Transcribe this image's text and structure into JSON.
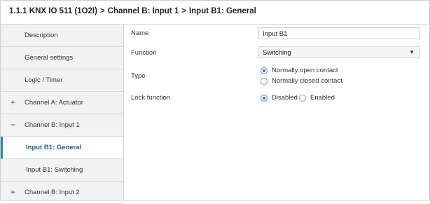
{
  "breadcrumb": {
    "device": "1.1.1 KNX IO 511 (1O2I)",
    "level1": "Channel B: Input 1",
    "level2": "Input B1: General",
    "separator": ">"
  },
  "sidebar": {
    "items": [
      {
        "label": "Description",
        "expander": ""
      },
      {
        "label": "General settings",
        "expander": ""
      },
      {
        "label": "Logic / Timer",
        "expander": ""
      },
      {
        "label": "Channel A: Actuator",
        "expander": "+"
      },
      {
        "label": "Channel B: Input 1",
        "expander": "−"
      },
      {
        "label": "Input B1: General",
        "expander": "",
        "active": true
      },
      {
        "label": "Input B1: Switching",
        "expander": ""
      },
      {
        "label": "Channel B: Input 2",
        "expander": "+"
      }
    ]
  },
  "params": {
    "name": {
      "label": "Name",
      "value": "Input B1"
    },
    "function": {
      "label": "Function",
      "value": "Switching",
      "icon": "chevron-down-icon"
    },
    "type": {
      "label": "Type",
      "options": [
        {
          "label": "Normally open contact",
          "selected": true
        },
        {
          "label": "Normally closed contact",
          "selected": false
        }
      ]
    },
    "lock": {
      "label": "Lock function",
      "options": [
        {
          "label": "Disabled",
          "selected": true
        },
        {
          "label": "Enabled",
          "selected": false
        }
      ]
    }
  },
  "colors": {
    "accent": "#2e8a9e",
    "active_text": "#1a5f8a",
    "sidebar_bg": "#f2f2f2",
    "radio_selected": "#3c6eaa"
  }
}
